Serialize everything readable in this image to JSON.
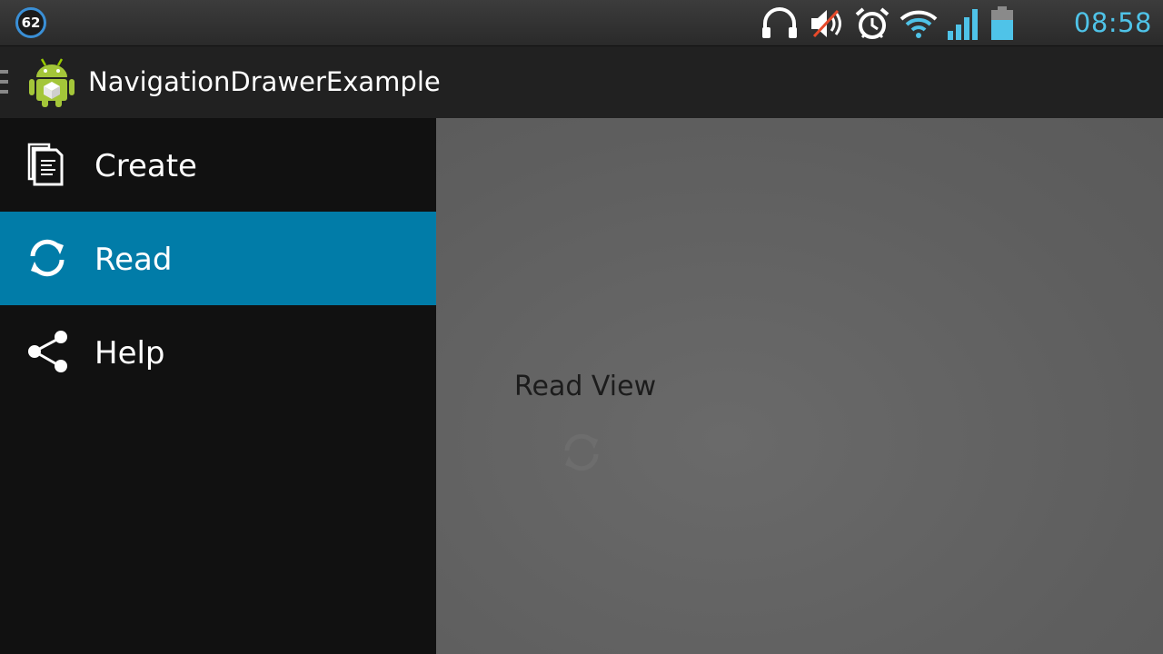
{
  "status_bar": {
    "notification_count": "62",
    "icons": [
      "headset-icon",
      "volume-muted-icon",
      "alarm-icon",
      "wifi-icon",
      "signal-icon",
      "battery-icon"
    ],
    "time": "08:58",
    "time_color": "#4fc3e8"
  },
  "action_bar": {
    "title": "NavigationDrawerExample",
    "icon": "android-app-icon",
    "drawer_indicator_icon": "drawer-indicator-icon"
  },
  "drawer": {
    "items": [
      {
        "label": "Create",
        "icon": "documents-icon",
        "selected": false
      },
      {
        "label": "Read",
        "icon": "refresh-icon",
        "selected": true
      },
      {
        "label": "Help",
        "icon": "share-icon",
        "selected": false
      }
    ],
    "selected_color": "#017ca8"
  },
  "content": {
    "title": "Read View",
    "icon": "refresh-icon"
  }
}
